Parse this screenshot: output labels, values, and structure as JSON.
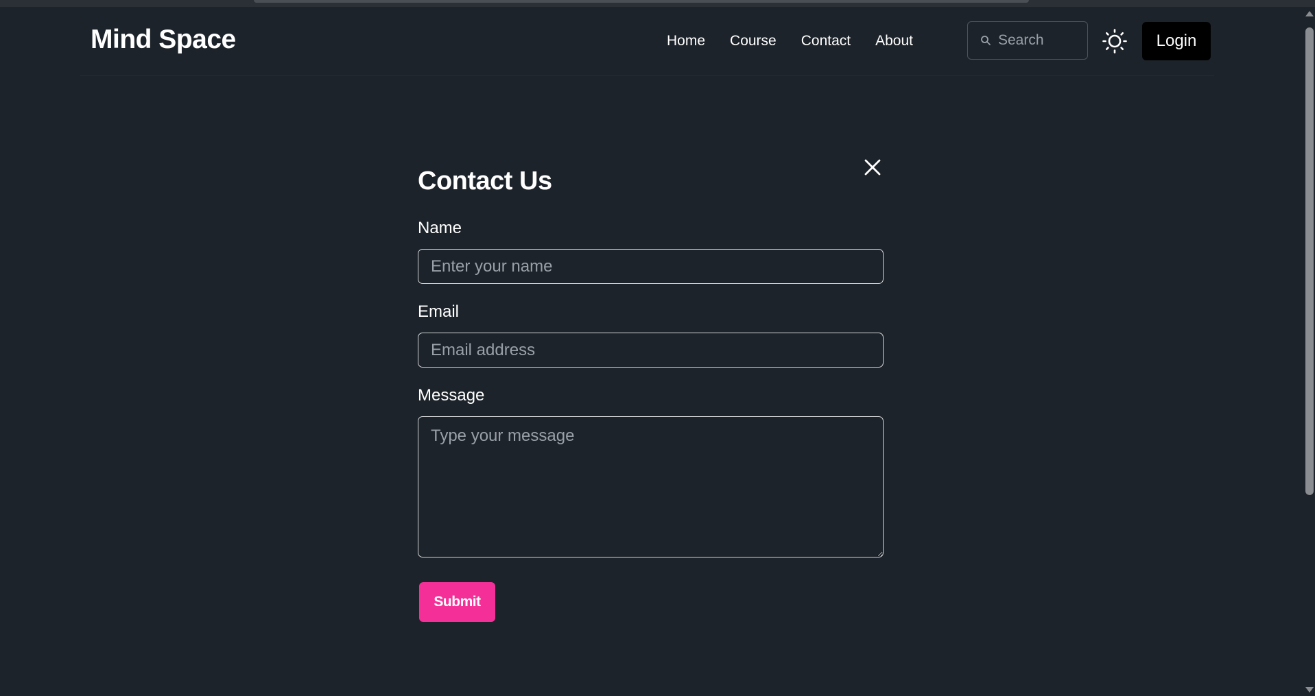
{
  "brand": {
    "name": "Mind Space"
  },
  "nav": {
    "links": [
      {
        "label": "Home"
      },
      {
        "label": "Course"
      },
      {
        "label": "Contact"
      },
      {
        "label": "About"
      }
    ],
    "search": {
      "placeholder": "Search",
      "icon": "search-icon"
    },
    "theme_toggle": {
      "icon": "sun-icon"
    },
    "login_label": "Login"
  },
  "contact": {
    "title": "Contact Us",
    "close_icon": "close-icon",
    "name": {
      "label": "Name",
      "placeholder": "Enter your name"
    },
    "email": {
      "label": "Email",
      "placeholder": "Email address"
    },
    "message": {
      "label": "Message",
      "placeholder": "Type your message"
    },
    "submit_label": "Submit"
  },
  "colors": {
    "background": "#1d232a",
    "accent": "#f43098",
    "login_bg": "#000000",
    "input_border": "#d6d8db"
  }
}
